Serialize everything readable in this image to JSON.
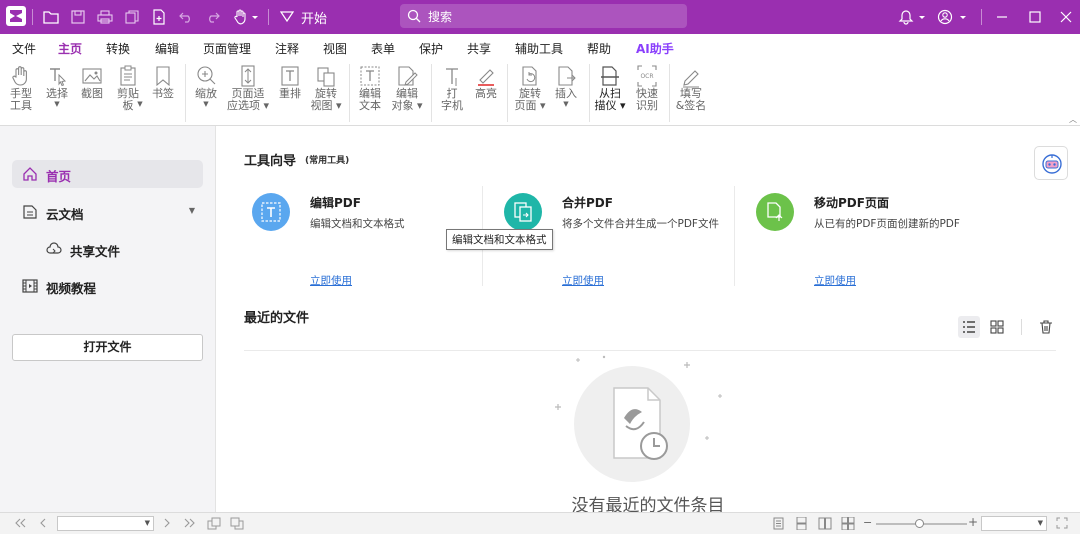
{
  "colors": {
    "brand": "#9a2fb0",
    "link": "#2a6fd6",
    "edit_pdf": "#5aa7ef",
    "merge_pdf": "#1fb6a8",
    "move_pages": "#6cc24a"
  },
  "toolbar": {
    "start_label": "开始",
    "search_placeholder": "搜索"
  },
  "menu_tabs": [
    "文件",
    "主页",
    "转换",
    "编辑",
    "页面管理",
    "注释",
    "视图",
    "表单",
    "保护",
    "共享",
    "辅助工具",
    "帮助",
    "AI助手"
  ],
  "active_tab": "主页",
  "ribbon": [
    {
      "icon": "hand-icon",
      "label": "手型\n工具"
    },
    {
      "icon": "select-icon",
      "label": "选择",
      "dropdown": true
    },
    {
      "icon": "screenshot-icon",
      "label": "截图"
    },
    {
      "icon": "clipboard-icon",
      "label": "剪贴\n板",
      "dropdown": true
    },
    {
      "icon": "bookmark-icon",
      "label": "书签"
    },
    {
      "icon": "zoom-icon",
      "label": "缩放",
      "dropdown": true
    },
    {
      "icon": "fit-page-icon",
      "label": "页面适\n应选项",
      "dropdown": true
    },
    {
      "icon": "reflow-icon",
      "label": "重排"
    },
    {
      "icon": "rotate-view-icon",
      "label": "旋转\n视图",
      "dropdown": true
    },
    {
      "icon": "edit-text-icon",
      "label": "编辑\n文本"
    },
    {
      "icon": "edit-object-icon",
      "label": "编辑\n对象",
      "dropdown": true
    },
    {
      "icon": "typewriter-icon",
      "label": "打\n字机"
    },
    {
      "icon": "highlight-icon",
      "label": "高亮"
    },
    {
      "icon": "rotate-page-icon",
      "label": "旋转\n页面",
      "dropdown": true
    },
    {
      "icon": "insert-icon",
      "label": "插入",
      "dropdown": true
    },
    {
      "icon": "scanner-icon",
      "label": "从扫\n描仪",
      "dropdown": true
    },
    {
      "icon": "ocr-icon",
      "label": "快速\n识别"
    },
    {
      "icon": "fill-sign-icon",
      "label": "填写\n&签名"
    }
  ],
  "sidebar": {
    "items": [
      {
        "label": "首页",
        "icon": "home-icon"
      },
      {
        "label": "云文档",
        "icon": "cloud-doc-icon"
      },
      {
        "label": "共享文件",
        "icon": "shared-cloud-icon"
      },
      {
        "label": "视频教程",
        "icon": "video-icon"
      }
    ],
    "open_button": "打开文件"
  },
  "tool_guide": {
    "title": "工具向导",
    "subtitle": "(常用工具)",
    "cards": [
      {
        "title": "编辑PDF",
        "desc": "编辑文档和文本格式",
        "link": "立即使用",
        "icon": "edit-pdf-icon"
      },
      {
        "title": "合并PDF",
        "desc": "将多个文件合并生成一个PDF文件",
        "link": "立即使用",
        "icon": "merge-pdf-icon"
      },
      {
        "title": "移动PDF页面",
        "desc": "从已有的PDF页面创建新的PDF",
        "link": "立即使用",
        "icon": "move-pages-icon"
      }
    ],
    "tooltip": "编辑文档和文本格式"
  },
  "recent": {
    "title": "最近的文件",
    "empty_text": "没有最近的文件条目",
    "view_mode": "list"
  }
}
